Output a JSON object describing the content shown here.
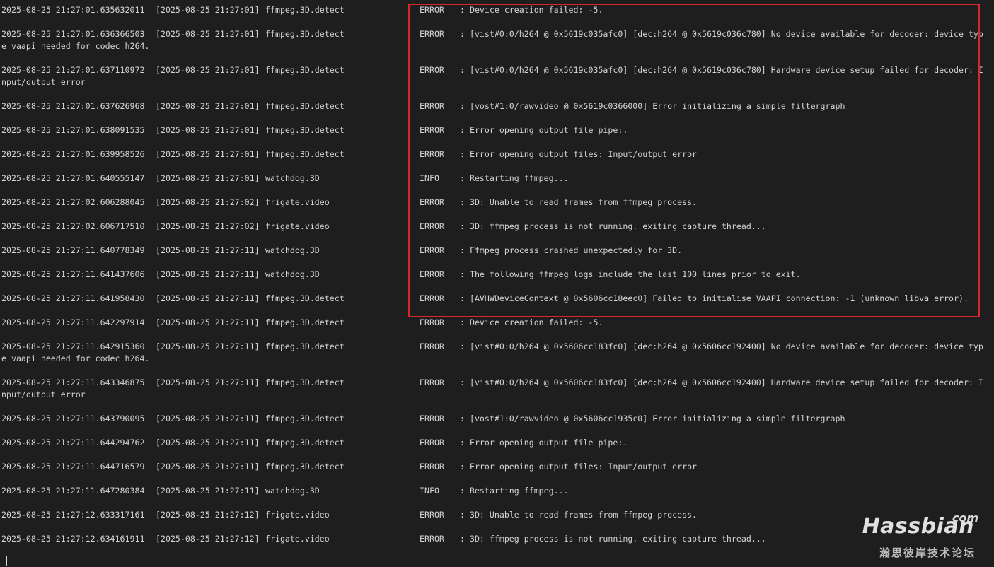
{
  "log": [
    {
      "timestamp": "2025-08-25 21:27:01.635632011",
      "logtime": "[2025-08-25 21:27:01]",
      "source": "ffmpeg.3D.detect",
      "level": "ERROR",
      "message": ": Device creation failed: -5."
    },
    {
      "timestamp": "2025-08-25 21:27:01.636366503",
      "logtime": "[2025-08-25 21:27:01]",
      "source": "ffmpeg.3D.detect",
      "level": "ERROR",
      "message": ": [vist#0:0/h264 @ 0x5619c035afc0] [dec:h264 @ 0x5619c036c780] No device available for decoder: device typ",
      "message_cont": "e vaapi needed for codec h264."
    },
    {
      "timestamp": "2025-08-25 21:27:01.637110972",
      "logtime": "[2025-08-25 21:27:01]",
      "source": "ffmpeg.3D.detect",
      "level": "ERROR",
      "message": ": [vist#0:0/h264 @ 0x5619c035afc0] [dec:h264 @ 0x5619c036c780] Hardware device setup failed for decoder: I",
      "message_cont": "nput/output error"
    },
    {
      "timestamp": "2025-08-25 21:27:01.637626968",
      "logtime": "[2025-08-25 21:27:01]",
      "source": "ffmpeg.3D.detect",
      "level": "ERROR",
      "message": ": [vost#1:0/rawvideo @ 0x5619c0366000] Error initializing a simple filtergraph"
    },
    {
      "timestamp": "2025-08-25 21:27:01.638091535",
      "logtime": "[2025-08-25 21:27:01]",
      "source": "ffmpeg.3D.detect",
      "level": "ERROR",
      "message": ": Error opening output file pipe:."
    },
    {
      "timestamp": "2025-08-25 21:27:01.639958526",
      "logtime": "[2025-08-25 21:27:01]",
      "source": "ffmpeg.3D.detect",
      "level": "ERROR",
      "message": ": Error opening output files: Input/output error"
    },
    {
      "timestamp": "2025-08-25 21:27:01.640555147",
      "logtime": "[2025-08-25 21:27:01]",
      "source": "watchdog.3D",
      "level": "INFO",
      "message": ": Restarting ffmpeg..."
    },
    {
      "timestamp": "2025-08-25 21:27:02.606288045",
      "logtime": "[2025-08-25 21:27:02]",
      "source": "frigate.video",
      "level": "ERROR",
      "message": ": 3D: Unable to read frames from ffmpeg process."
    },
    {
      "timestamp": "2025-08-25 21:27:02.606717510",
      "logtime": "[2025-08-25 21:27:02]",
      "source": "frigate.video",
      "level": "ERROR",
      "message": ": 3D: ffmpeg process is not running. exiting capture thread..."
    },
    {
      "timestamp": "2025-08-25 21:27:11.640778349",
      "logtime": "[2025-08-25 21:27:11]",
      "source": "watchdog.3D",
      "level": "ERROR",
      "message": ": Ffmpeg process crashed unexpectedly for 3D."
    },
    {
      "timestamp": "2025-08-25 21:27:11.641437606",
      "logtime": "[2025-08-25 21:27:11]",
      "source": "watchdog.3D",
      "level": "ERROR",
      "message": ": The following ffmpeg logs include the last 100 lines prior to exit."
    },
    {
      "timestamp": "2025-08-25 21:27:11.641958430",
      "logtime": "[2025-08-25 21:27:11]",
      "source": "ffmpeg.3D.detect",
      "level": "ERROR",
      "message": ": [AVHWDeviceContext @ 0x5606cc18eec0] Failed to initialise VAAPI connection: -1 (unknown libva error)."
    },
    {
      "timestamp": "2025-08-25 21:27:11.642297914",
      "logtime": "[2025-08-25 21:27:11]",
      "source": "ffmpeg.3D.detect",
      "level": "ERROR",
      "message": ": Device creation failed: -5."
    },
    {
      "timestamp": "2025-08-25 21:27:11.642915360",
      "logtime": "[2025-08-25 21:27:11]",
      "source": "ffmpeg.3D.detect",
      "level": "ERROR",
      "message": ": [vist#0:0/h264 @ 0x5606cc183fc0] [dec:h264 @ 0x5606cc192400] No device available for decoder: device typ",
      "message_cont": "e vaapi needed for codec h264."
    },
    {
      "timestamp": "2025-08-25 21:27:11.643346875",
      "logtime": "[2025-08-25 21:27:11]",
      "source": "ffmpeg.3D.detect",
      "level": "ERROR",
      "message": ": [vist#0:0/h264 @ 0x5606cc183fc0] [dec:h264 @ 0x5606cc192400] Hardware device setup failed for decoder: I",
      "message_cont": "nput/output error"
    },
    {
      "timestamp": "2025-08-25 21:27:11.643790095",
      "logtime": "[2025-08-25 21:27:11]",
      "source": "ffmpeg.3D.detect",
      "level": "ERROR",
      "message": ": [vost#1:0/rawvideo @ 0x5606cc1935c0] Error initializing a simple filtergraph"
    },
    {
      "timestamp": "2025-08-25 21:27:11.644294762",
      "logtime": "[2025-08-25 21:27:11]",
      "source": "ffmpeg.3D.detect",
      "level": "ERROR",
      "message": ": Error opening output file pipe:."
    },
    {
      "timestamp": "2025-08-25 21:27:11.644716579",
      "logtime": "[2025-08-25 21:27:11]",
      "source": "ffmpeg.3D.detect",
      "level": "ERROR",
      "message": ": Error opening output files: Input/output error"
    },
    {
      "timestamp": "2025-08-25 21:27:11.647280384",
      "logtime": "[2025-08-25 21:27:11]",
      "source": "watchdog.3D",
      "level": "INFO",
      "message": ": Restarting ffmpeg..."
    },
    {
      "timestamp": "2025-08-25 21:27:12.633317161",
      "logtime": "[2025-08-25 21:27:12]",
      "source": "frigate.video",
      "level": "ERROR",
      "message": ": 3D: Unable to read frames from ffmpeg process."
    },
    {
      "timestamp": "2025-08-25 21:27:12.634161911",
      "logtime": "[2025-08-25 21:27:12]",
      "source": "frigate.video",
      "level": "ERROR",
      "message": ": 3D: ffmpeg process is not running. exiting capture thread..."
    }
  ],
  "watermark": {
    "com": "com",
    "name": "Hassbian",
    "subtitle": "瀚思彼岸技术论坛"
  },
  "colors": {
    "background": "#1e1e1e",
    "text": "#d4d4d4",
    "highlight_border": "#d6262f"
  }
}
